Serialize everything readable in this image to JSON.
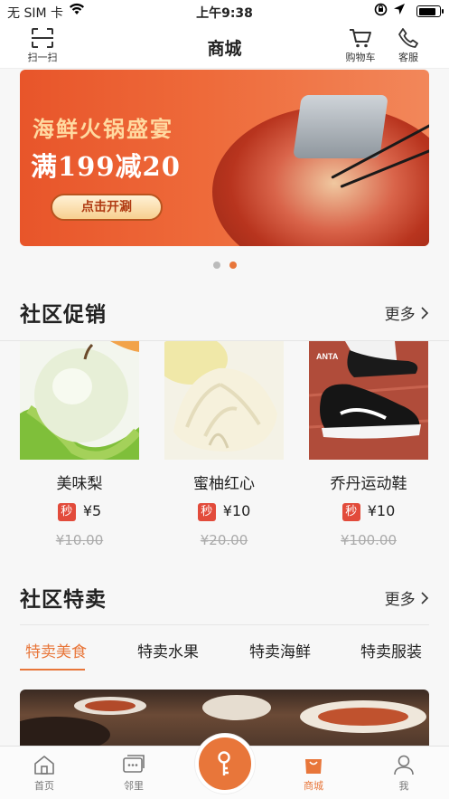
{
  "status_bar": {
    "carrier": "无 SIM 卡",
    "time": "上午9:38",
    "battery_level": 0.9
  },
  "nav": {
    "title": "商城",
    "scan_label": "扫一扫",
    "cart_label": "购物车",
    "service_label": "客服"
  },
  "banner": {
    "headline": "海鲜火锅盛宴",
    "promo": "满199减20",
    "cta": "点击开涮",
    "page_count": 2,
    "active_page": 2
  },
  "promo_section": {
    "title": "社区促销",
    "more": "更多",
    "products": [
      {
        "name": "美味梨",
        "tag": "秒",
        "price": "¥5",
        "original": "¥10.00"
      },
      {
        "name": "蜜柚红心",
        "tag": "秒",
        "price": "¥10",
        "original": "¥20.00"
      },
      {
        "name": "乔丹运动鞋",
        "tag": "秒",
        "price": "¥10",
        "original": "¥100.00"
      }
    ]
  },
  "special_section": {
    "title": "社区特卖",
    "more": "更多",
    "tabs": [
      "特卖美食",
      "特卖水果",
      "特卖海鲜",
      "特卖服装"
    ],
    "active_tab": 0
  },
  "tabbar": {
    "items": [
      {
        "label": "首页",
        "icon": "home-icon"
      },
      {
        "label": "邻里",
        "icon": "chat-icon"
      },
      {
        "label": "",
        "icon": "key-icon"
      },
      {
        "label": "商城",
        "icon": "shopping-bag-icon"
      },
      {
        "label": "我",
        "icon": "person-icon"
      }
    ],
    "active_index": 3
  },
  "colors": {
    "accent": "#e8763a",
    "sale_tag": "#e24b3b",
    "banner": "#e8552a"
  }
}
